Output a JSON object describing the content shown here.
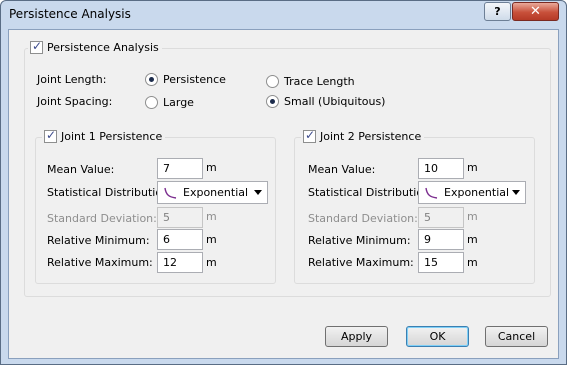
{
  "window": {
    "title": "Persistence Analysis",
    "help_label": "?",
    "close_label": "✕"
  },
  "main": {
    "enabled": true,
    "label": "Persistence Analysis",
    "joint_length": {
      "label": "Joint Length:",
      "options": [
        "Persistence",
        "Trace Length"
      ],
      "selected": "Persistence"
    },
    "joint_spacing": {
      "label": "Joint Spacing:",
      "options": [
        "Large",
        "Small (Ubiquitous)"
      ],
      "selected": "Small (Ubiquitous)"
    }
  },
  "joint1": {
    "label": "Joint 1 Persistence",
    "enabled": true,
    "mean_label": "Mean Value:",
    "mean_value": "7",
    "mean_unit": "m",
    "dist_label": "Statistical Distribution:",
    "dist_value": "Exponential",
    "dist_icon": "exponential-curve-icon",
    "std_label": "Standard Deviation:",
    "std_value": "5",
    "std_unit": "m",
    "min_label": "Relative Minimum:",
    "min_value": "6",
    "min_unit": "m",
    "max_label": "Relative Maximum:",
    "max_value": "12",
    "max_unit": "m"
  },
  "joint2": {
    "label": "Joint 2 Persistence",
    "enabled": true,
    "mean_label": "Mean Value:",
    "mean_value": "10",
    "mean_unit": "m",
    "dist_label": "Statistical Distribution:",
    "dist_value": "Exponential",
    "dist_icon": "exponential-curve-icon",
    "std_label": "Standard Deviation:",
    "std_value": "5",
    "std_unit": "m",
    "min_label": "Relative Minimum:",
    "min_value": "9",
    "min_unit": "m",
    "max_label": "Relative Maximum:",
    "max_value": "15",
    "max_unit": "m"
  },
  "buttons": {
    "apply": "Apply",
    "ok": "OK",
    "cancel": "Cancel"
  },
  "colors": {
    "title_bar": "#c9d9ed",
    "close_button": "#c8503a",
    "curve": "#7b2d8e",
    "dialog_bg": "#f0f0f0"
  }
}
